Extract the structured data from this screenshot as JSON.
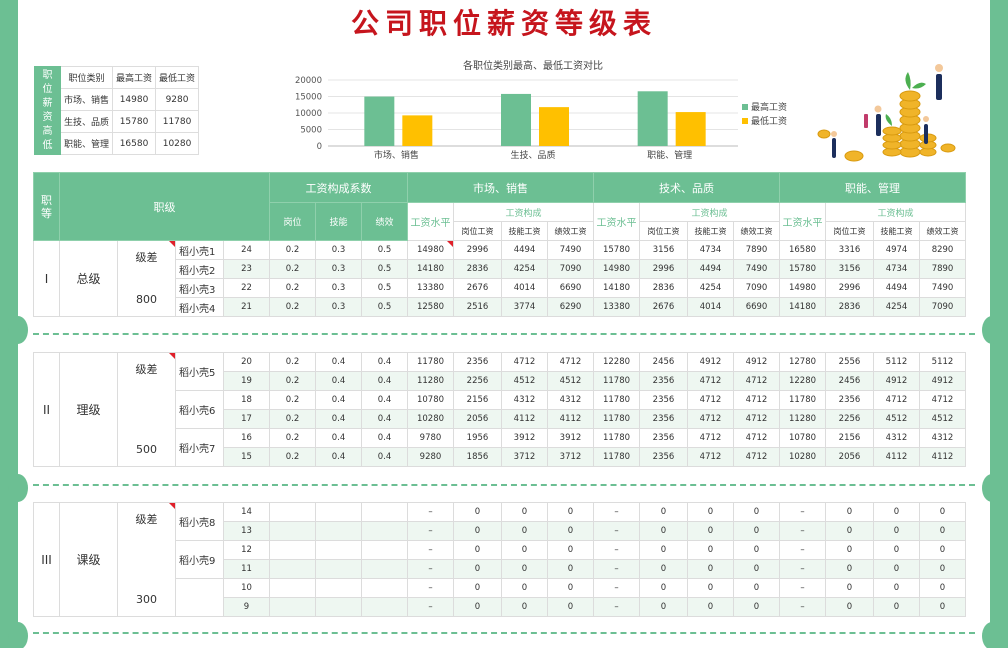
{
  "title": "公司职位薪资等级表",
  "summary": {
    "side_label": "职位薪资高低",
    "headers": [
      "职位类别",
      "最高工资",
      "最低工资"
    ],
    "rows": [
      [
        "市场、销售",
        "14980",
        "9280"
      ],
      [
        "生技、品质",
        "15780",
        "11780"
      ],
      [
        "职能、管理",
        "16580",
        "10280"
      ]
    ]
  },
  "chart_data": {
    "type": "bar",
    "title": "各职位类别最高、最低工资对比",
    "categories": [
      "市场、销售",
      "生技、品质",
      "职能、管理"
    ],
    "series": [
      {
        "name": "最高工资",
        "values": [
          14980,
          15780,
          16580
        ],
        "color": "#6cbf93"
      },
      {
        "name": "最低工资",
        "values": [
          9280,
          11780,
          10280
        ],
        "color": "#ffc000"
      }
    ],
    "ylim": [
      0,
      20000
    ],
    "yticks": [
      "0",
      "5000",
      "10000",
      "15000",
      "20000"
    ],
    "legend": "right",
    "grid": true
  },
  "header": {
    "rank": "职等",
    "level": "职级",
    "coef": "工资构成系数",
    "cat1": "市场、销售",
    "cat2": "技术、品质",
    "cat3": "职能、管理",
    "coef_cols": [
      "岗位",
      "技能",
      "绩效"
    ],
    "wage_level": "工资水平",
    "wage_comp": "工资构成",
    "comp_cols": [
      "岗位工资",
      "技能工资",
      "绩效工资"
    ]
  },
  "groups": [
    {
      "rank": "I",
      "name": "总级",
      "diff_label": "级差",
      "diff": "800",
      "people": [
        "稻小壳1",
        "稻小壳2",
        "稻小壳3",
        "稻小壳4"
      ],
      "rows": [
        [
          "24",
          "0.2",
          "0.3",
          "0.5",
          "14980",
          "2996",
          "4494",
          "7490",
          "15780",
          "3156",
          "4734",
          "7890",
          "16580",
          "3316",
          "4974",
          "8290"
        ],
        [
          "23",
          "0.2",
          "0.3",
          "0.5",
          "14180",
          "2836",
          "4254",
          "7090",
          "14980",
          "2996",
          "4494",
          "7490",
          "15780",
          "3156",
          "4734",
          "7890"
        ],
        [
          "22",
          "0.2",
          "0.3",
          "0.5",
          "13380",
          "2676",
          "4014",
          "6690",
          "14180",
          "2836",
          "4254",
          "7090",
          "14980",
          "2996",
          "4494",
          "7490"
        ],
        [
          "21",
          "0.2",
          "0.3",
          "0.5",
          "12580",
          "2516",
          "3774",
          "6290",
          "13380",
          "2676",
          "4014",
          "6690",
          "14180",
          "2836",
          "4254",
          "7090"
        ]
      ]
    },
    {
      "rank": "II",
      "name": "理级",
      "diff_label": "级差",
      "diff": "500",
      "people": [
        "稻小壳5",
        "稻小壳6",
        "稻小壳7"
      ],
      "rows": [
        [
          "20",
          "0.2",
          "0.4",
          "0.4",
          "11780",
          "2356",
          "4712",
          "4712",
          "12280",
          "2456",
          "4912",
          "4912",
          "12780",
          "2556",
          "5112",
          "5112"
        ],
        [
          "19",
          "0.2",
          "0.4",
          "0.4",
          "11280",
          "2256",
          "4512",
          "4512",
          "11780",
          "2356",
          "4712",
          "4712",
          "12280",
          "2456",
          "4912",
          "4912"
        ],
        [
          "18",
          "0.2",
          "0.4",
          "0.4",
          "10780",
          "2156",
          "4312",
          "4312",
          "11780",
          "2356",
          "4712",
          "4712",
          "11780",
          "2356",
          "4712",
          "4712"
        ],
        [
          "17",
          "0.2",
          "0.4",
          "0.4",
          "10280",
          "2056",
          "4112",
          "4112",
          "11780",
          "2356",
          "4712",
          "4712",
          "11280",
          "2256",
          "4512",
          "4512"
        ],
        [
          "16",
          "0.2",
          "0.4",
          "0.4",
          "9780",
          "1956",
          "3912",
          "3912",
          "11780",
          "2356",
          "4712",
          "4712",
          "10780",
          "2156",
          "4312",
          "4312"
        ],
        [
          "15",
          "0.2",
          "0.4",
          "0.4",
          "9280",
          "1856",
          "3712",
          "3712",
          "11780",
          "2356",
          "4712",
          "4712",
          "10280",
          "2056",
          "4112",
          "4112"
        ]
      ]
    },
    {
      "rank": "III",
      "name": "课级",
      "diff_label": "级差",
      "diff": "300",
      "people": [
        "稻小壳8",
        "稻小壳9"
      ],
      "rows": [
        [
          "14",
          "",
          "",
          "",
          "–",
          "0",
          "0",
          "0",
          "–",
          "0",
          "0",
          "0",
          "–",
          "0",
          "0",
          "0"
        ],
        [
          "13",
          "",
          "",
          "",
          "–",
          "0",
          "0",
          "0",
          "–",
          "0",
          "0",
          "0",
          "–",
          "0",
          "0",
          "0"
        ],
        [
          "12",
          "",
          "",
          "",
          "–",
          "0",
          "0",
          "0",
          "–",
          "0",
          "0",
          "0",
          "–",
          "0",
          "0",
          "0"
        ],
        [
          "11",
          "",
          "",
          "",
          "–",
          "0",
          "0",
          "0",
          "–",
          "0",
          "0",
          "0",
          "–",
          "0",
          "0",
          "0"
        ],
        [
          "10",
          "",
          "",
          "",
          "–",
          "0",
          "0",
          "0",
          "–",
          "0",
          "0",
          "0",
          "–",
          "0",
          "0",
          "0"
        ],
        [
          "9",
          "",
          "",
          "",
          "–",
          "0",
          "0",
          "0",
          "–",
          "0",
          "0",
          "0",
          "–",
          "0",
          "0",
          "0"
        ]
      ]
    }
  ]
}
